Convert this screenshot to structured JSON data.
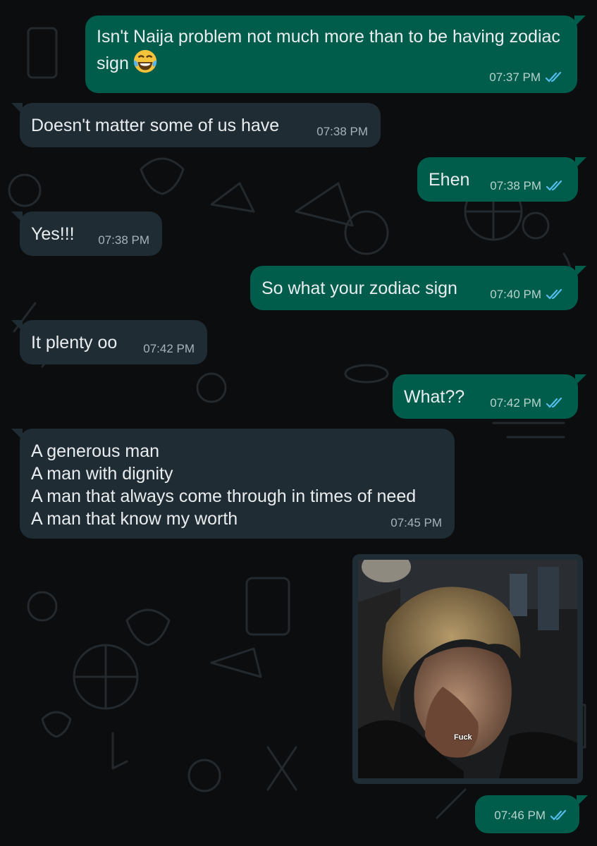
{
  "colors": {
    "background": "#0b0d0f",
    "outgoing_bubble": "#005c4b",
    "incoming_bubble": "#1f2c33",
    "read_ticks": "#53bdeb",
    "text": "#e9edef"
  },
  "messages": [
    {
      "direction": "outgoing",
      "text": "Isn't Naija problem not much more than to be having zodiac sign",
      "emoji": "face-with-tears-of-joy",
      "time": "07:37 PM",
      "status": "read"
    },
    {
      "direction": "incoming",
      "text": "Doesn't matter some of us have",
      "time": "07:38 PM"
    },
    {
      "direction": "outgoing",
      "text": "Ehen",
      "time": "07:38 PM",
      "status": "read"
    },
    {
      "direction": "incoming",
      "text": "Yes!!!",
      "time": "07:38 PM"
    },
    {
      "direction": "outgoing",
      "text": "So what your zodiac sign",
      "time": "07:40 PM",
      "status": "read"
    },
    {
      "direction": "incoming",
      "text": "It plenty oo",
      "time": "07:42 PM"
    },
    {
      "direction": "outgoing",
      "text": "What??",
      "time": "07:42 PM",
      "status": "read"
    },
    {
      "direction": "incoming",
      "text": "A generous man\nA man with dignity\nA man that always come through in times of need\nA man that know my worth",
      "time": "07:45 PM"
    },
    {
      "direction": "outgoing",
      "type": "gif",
      "gif_caption": "Fuck",
      "status": "read"
    },
    {
      "direction": "outgoing",
      "time": "07:46 PM",
      "status": "read"
    }
  ]
}
